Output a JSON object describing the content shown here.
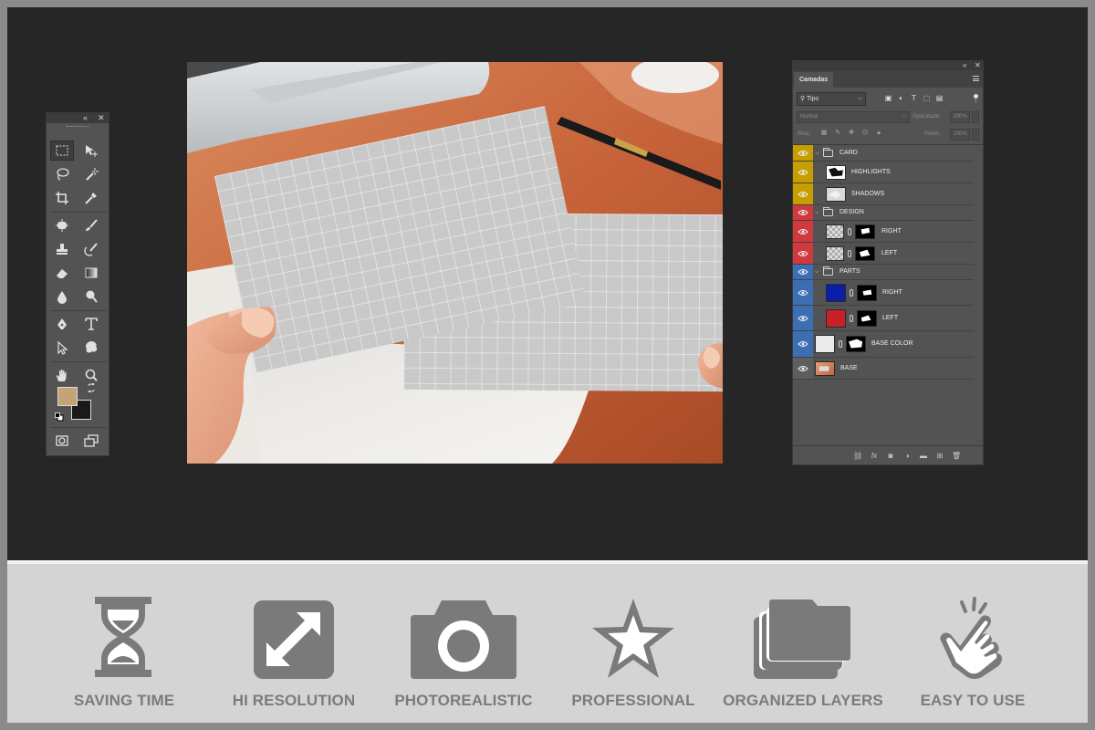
{
  "layers_panel": {
    "tab_title": "Camadas",
    "filter_label": "Tipo",
    "blend_mode": "Normal",
    "opacity_label": "Opacidade:",
    "opacity_value": "100%",
    "lock_label": "Bloq.:",
    "fill_label": "Preen.:",
    "fill_value": "100%",
    "layers": [
      {
        "name": "CARD",
        "type": "group",
        "color": "#c79e00"
      },
      {
        "name": "HIGHLIGHTS",
        "type": "layer",
        "color": "#c79e00"
      },
      {
        "name": "SHADOWS",
        "type": "layer",
        "color": "#c79e00"
      },
      {
        "name": "DESIGN",
        "type": "group",
        "color": "#d0393e"
      },
      {
        "name": "RIGHT",
        "type": "smart",
        "color": "#d0393e"
      },
      {
        "name": "LEFT",
        "type": "smart",
        "color": "#d0393e"
      },
      {
        "name": "PARTS",
        "type": "group",
        "color": "#3c6eb4"
      },
      {
        "name": "RIGHT",
        "type": "fill",
        "color": "#3c6eb4",
        "swatch": "#0b1ea8"
      },
      {
        "name": "LEFT",
        "type": "fill",
        "color": "#3c6eb4",
        "swatch": "#c8202a"
      },
      {
        "name": "BASE COLOR",
        "type": "fill",
        "color": "#3c6eb4",
        "swatch": "#eaeaea"
      },
      {
        "name": "BASE",
        "type": "image",
        "color": "#5e5e5e"
      }
    ]
  },
  "colors": {
    "foreground": "#c4a477",
    "background": "#1a1a1a"
  },
  "features": [
    {
      "label": "SAVING TIME",
      "icon": "hourglass-icon"
    },
    {
      "label": "HI RESOLUTION",
      "icon": "expand-icon"
    },
    {
      "label": "PHOTOREALISTIC",
      "icon": "camera-icon"
    },
    {
      "label": "PROFESSIONAL",
      "icon": "star-icon"
    },
    {
      "label": "ORGANIZED LAYERS",
      "icon": "layers-icon"
    },
    {
      "label": "EASY TO USE",
      "icon": "hand-pointer-icon"
    }
  ]
}
